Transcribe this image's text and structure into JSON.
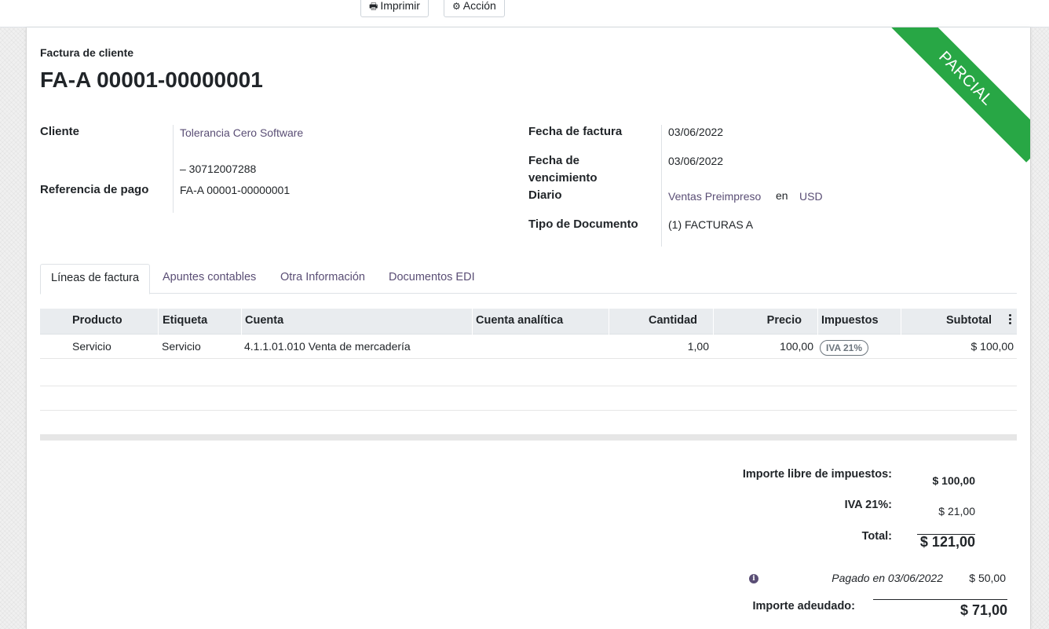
{
  "toolbar": {
    "print_label": "Imprimir",
    "print_icon": "print-icon",
    "action_label": "Acción",
    "action_icon": "gear-icon"
  },
  "status_ribbon": {
    "label": "PARCIAL",
    "color": "#28a745"
  },
  "header": {
    "doc_type": "Factura de cliente",
    "doc_name": "FA-A 00001-00000001"
  },
  "left_fields": {
    "customer_label": "Cliente",
    "customer_value": "Tolerancia Cero Software",
    "customer_cuit": "– 30712007288",
    "payment_ref_label": "Referencia de pago",
    "payment_ref_value": "FA-A 00001-00000001"
  },
  "right_fields": {
    "invoice_date_label": "Fecha de factura",
    "invoice_date_value": "03/06/2022",
    "due_date_label_1": "Fecha de",
    "due_date_label_2": "vencimiento",
    "due_date_value": "03/06/2022",
    "journal_label": "Diario",
    "journal_value": "Ventas Preimpreso",
    "journal_in": "en",
    "currency_value": "USD",
    "doc_type_label": "Tipo de Documento",
    "doc_type_value": "(1) FACTURAS A"
  },
  "tabs": [
    {
      "label": "Líneas de factura",
      "active": true
    },
    {
      "label": "Apuntes contables",
      "active": false
    },
    {
      "label": "Otra Información",
      "active": false
    },
    {
      "label": "Documentos EDI",
      "active": false
    }
  ],
  "table": {
    "columns": [
      "Producto",
      "Etiqueta",
      "Cuenta",
      "Cuenta analítica",
      "Cantidad",
      "Precio",
      "Impuestos",
      "Subtotal"
    ],
    "rows": [
      {
        "product": "Servicio",
        "label": "Servicio",
        "account": "4.1.1.01.010 Venta de mercadería",
        "analytic": "",
        "quantity": "1,00",
        "price": "100,00",
        "tax": "IVA 21%",
        "subtotal": "$ 100,00"
      }
    ]
  },
  "totals": {
    "untaxed_label": "Importe libre de impuestos:",
    "untaxed_value": "$ 100,00",
    "tax_label": "IVA 21%:",
    "tax_value": "$ 21,00",
    "total_label": "Total:",
    "total_value": "$ 121,00",
    "payment_text": "Pagado en 03/06/2022",
    "payment_value": "$ 50,00",
    "due_label": "Importe adeudado:",
    "due_value": "$ 71,00"
  }
}
